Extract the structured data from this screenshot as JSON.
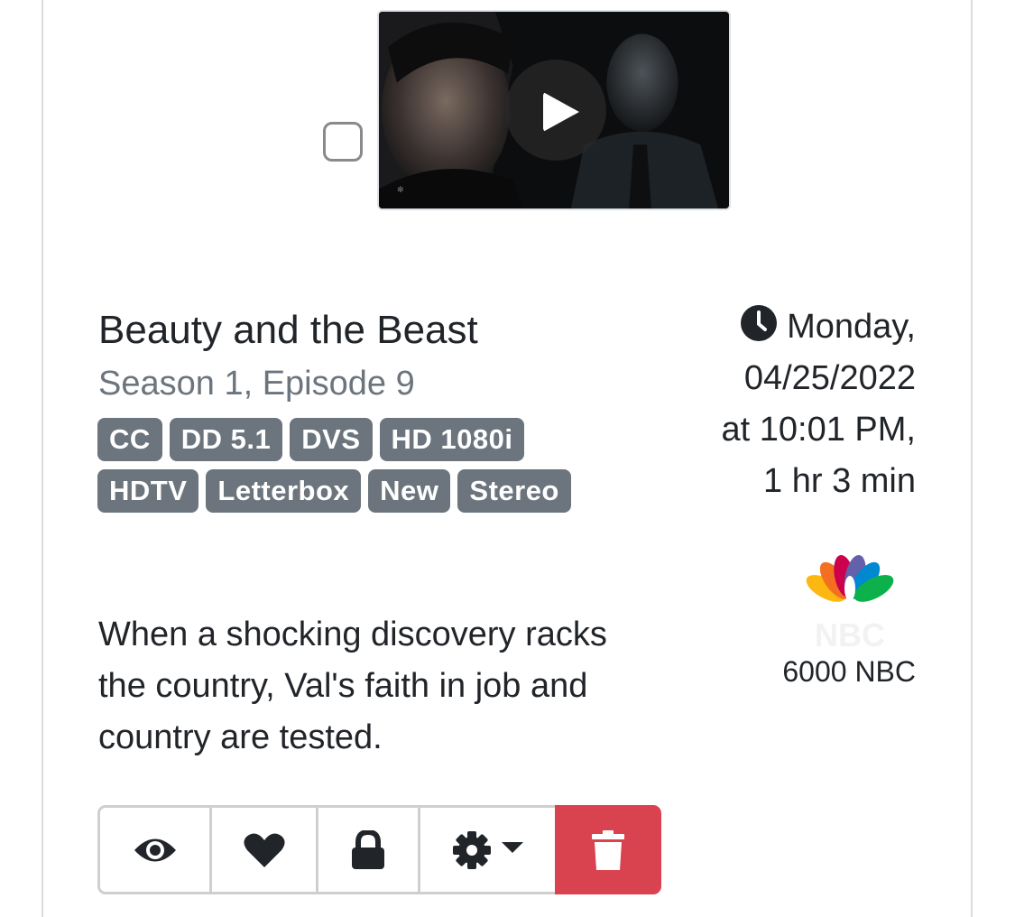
{
  "recording": {
    "title": "Beauty and the Beast",
    "subtitle": "Season 1, Episode 9",
    "badges": [
      "CC",
      "DD 5.1",
      "DVS",
      "HD 1080i",
      "HDTV",
      "Letterbox",
      "New",
      "Stereo"
    ],
    "description": "When a shocking discovery racks the country, Val's faith in job and country are tested.",
    "airtime": {
      "day": "Monday,",
      "date": "04/25/2022",
      "time": "at 10:01 PM,",
      "duration": "1 hr 3 min"
    },
    "channel": "6000 NBC",
    "selected": false
  },
  "icons": {
    "clock": "clock-icon",
    "play": "play-icon",
    "watched": "eye-icon",
    "favorite": "heart-icon",
    "protect": "lock-icon",
    "settings": "gear-icon",
    "dropdown": "caret-down-icon",
    "delete": "trash-icon",
    "network_logo": "nbc-peacock-logo"
  },
  "colors": {
    "badge": "#6c757d",
    "danger": "#d9434f",
    "subtitle": "#6c757d",
    "text": "#212529"
  }
}
